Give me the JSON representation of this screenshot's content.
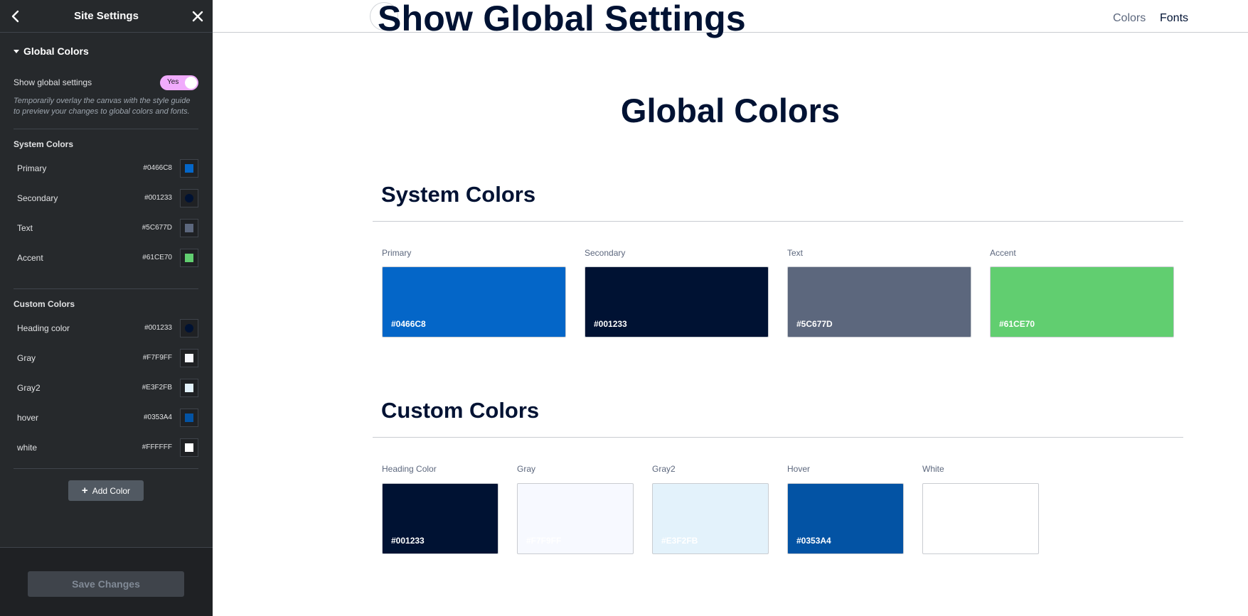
{
  "sidebar": {
    "title": "Site Settings",
    "section_title": "Global Colors",
    "toggle_label": "Show global settings",
    "toggle_value": "Yes",
    "help_text": "Temporarily overlay the canvas with the style guide to preview your changes to global colors and fonts.",
    "system_title": "System Colors",
    "system_colors": [
      {
        "name": "Primary",
        "hex": "#0466C8",
        "color": "#0466C8"
      },
      {
        "name": "Secondary",
        "hex": "#001233",
        "color": "#001233"
      },
      {
        "name": "Text",
        "hex": "#5C677D",
        "color": "#5C677D"
      },
      {
        "name": "Accent",
        "hex": "#61CE70",
        "color": "#61CE70"
      }
    ],
    "custom_title": "Custom Colors",
    "custom_colors": [
      {
        "name": "Heading color",
        "hex": "#001233",
        "color": "#001233"
      },
      {
        "name": "Gray",
        "hex": "#F7F9FF",
        "color": "#F7F9FF"
      },
      {
        "name": "Gray2",
        "hex": "#E3F2FB",
        "color": "#E3F2FB"
      },
      {
        "name": "hover",
        "hex": "#0353A4",
        "color": "#0353A4"
      },
      {
        "name": "white",
        "hex": "#FFFFFF",
        "color": "#FFFFFF"
      }
    ],
    "add_color_label": "Add Color",
    "save_label": "Save Changes"
  },
  "canvas": {
    "page_title": "Show Global Settings",
    "nav": {
      "colors": "Colors",
      "fonts": "Fonts"
    },
    "heading": "Global Colors",
    "system_heading": "System Colors",
    "system_cards": [
      {
        "label": "Primary",
        "hex": "#0466C8",
        "color": "#0466C8",
        "text_color": "#ffffff"
      },
      {
        "label": "Secondary",
        "hex": "#001233",
        "color": "#001233",
        "text_color": "#ffffff"
      },
      {
        "label": "Text",
        "hex": "#5C677D",
        "color": "#5C677D",
        "text_color": "#ffffff"
      },
      {
        "label": "Accent",
        "hex": "#61CE70",
        "color": "#61CE70",
        "text_color": "#ffffff"
      }
    ],
    "custom_heading": "Custom Colors",
    "custom_cards": [
      {
        "label": "Heading Color",
        "hex": "#001233",
        "color": "#001233",
        "text_color": "#ffffff"
      },
      {
        "label": "Gray",
        "hex": "#F7F9FF",
        "color": "#F7F9FF",
        "text_color": "#ffffff"
      },
      {
        "label": "Gray2",
        "hex": "#E3F2FB",
        "color": "#E3F2FB",
        "text_color": "#ffffff"
      },
      {
        "label": "Hover",
        "hex": "#0353A4",
        "color": "#0353A4",
        "text_color": "#ffffff"
      },
      {
        "label": "White",
        "hex": "#FFFFFF",
        "color": "#FFFFFF",
        "text_color": "#ffffff"
      }
    ]
  }
}
